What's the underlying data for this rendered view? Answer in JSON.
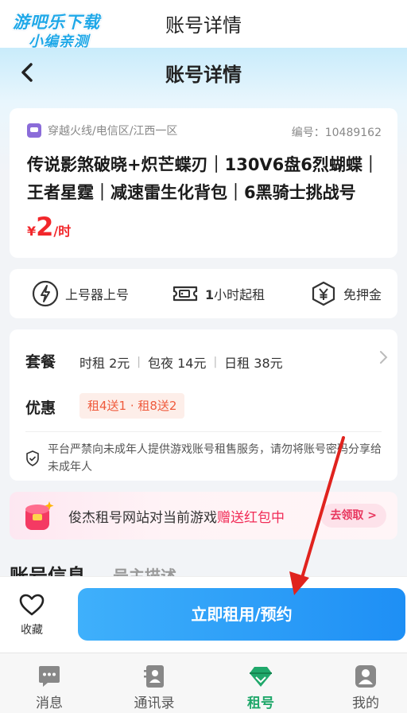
{
  "outer": {
    "title": "账号详情",
    "watermark_line1": "游吧乐下载",
    "watermark_line2": "小编亲测"
  },
  "nav": {
    "title": "账号详情"
  },
  "account": {
    "server": "穿越火线/电信区/江西一区",
    "code": "编号：10489162",
    "title": "传说影煞破晓+炽芒蝶刃｜130V6盘6烈蝴蝶｜王者星霆｜减速雷生化背包｜6黑骑士挑战号",
    "price": {
      "currency": "¥",
      "value": "2",
      "unit": "/时"
    }
  },
  "features": [
    {
      "label": "上号器上号",
      "icon": "lightning-icon"
    },
    {
      "label_bold": "1",
      "label": "小时起租",
      "icon": "ticket-icon"
    },
    {
      "label": "免押金",
      "icon": "yen-shield-icon"
    }
  ],
  "package": {
    "label": "套餐",
    "items": [
      "时租 2元",
      "包夜 14元",
      "日租 38元"
    ]
  },
  "promo": {
    "label": "优惠",
    "badge": "租4送1 · 租8送2"
  },
  "notice": "平台严禁向未成年人提供游戏账号租售服务，请勿将账号密码分享给未成年人",
  "banner": {
    "text_prefix": "俊杰租号网站对当前游戏",
    "text_highlight": "赠送红包中",
    "button": "去领取 >"
  },
  "tabs": {
    "main": "账号信息",
    "sub": "号主描述"
  },
  "actions": {
    "favorite": "收藏",
    "rent": "立即租用/预约"
  },
  "tabbar": [
    {
      "label": "消息",
      "icon": "message-icon"
    },
    {
      "label": "通讯录",
      "icon": "contacts-icon"
    },
    {
      "label": "租号",
      "icon": "diamond-icon"
    },
    {
      "label": "我的",
      "icon": "profile-icon"
    }
  ],
  "colors": {
    "price": "#f2272b",
    "primary_button": "#2a9bf7",
    "active_tab": "#20a86b",
    "annotation_arrow": "#e0231e"
  }
}
